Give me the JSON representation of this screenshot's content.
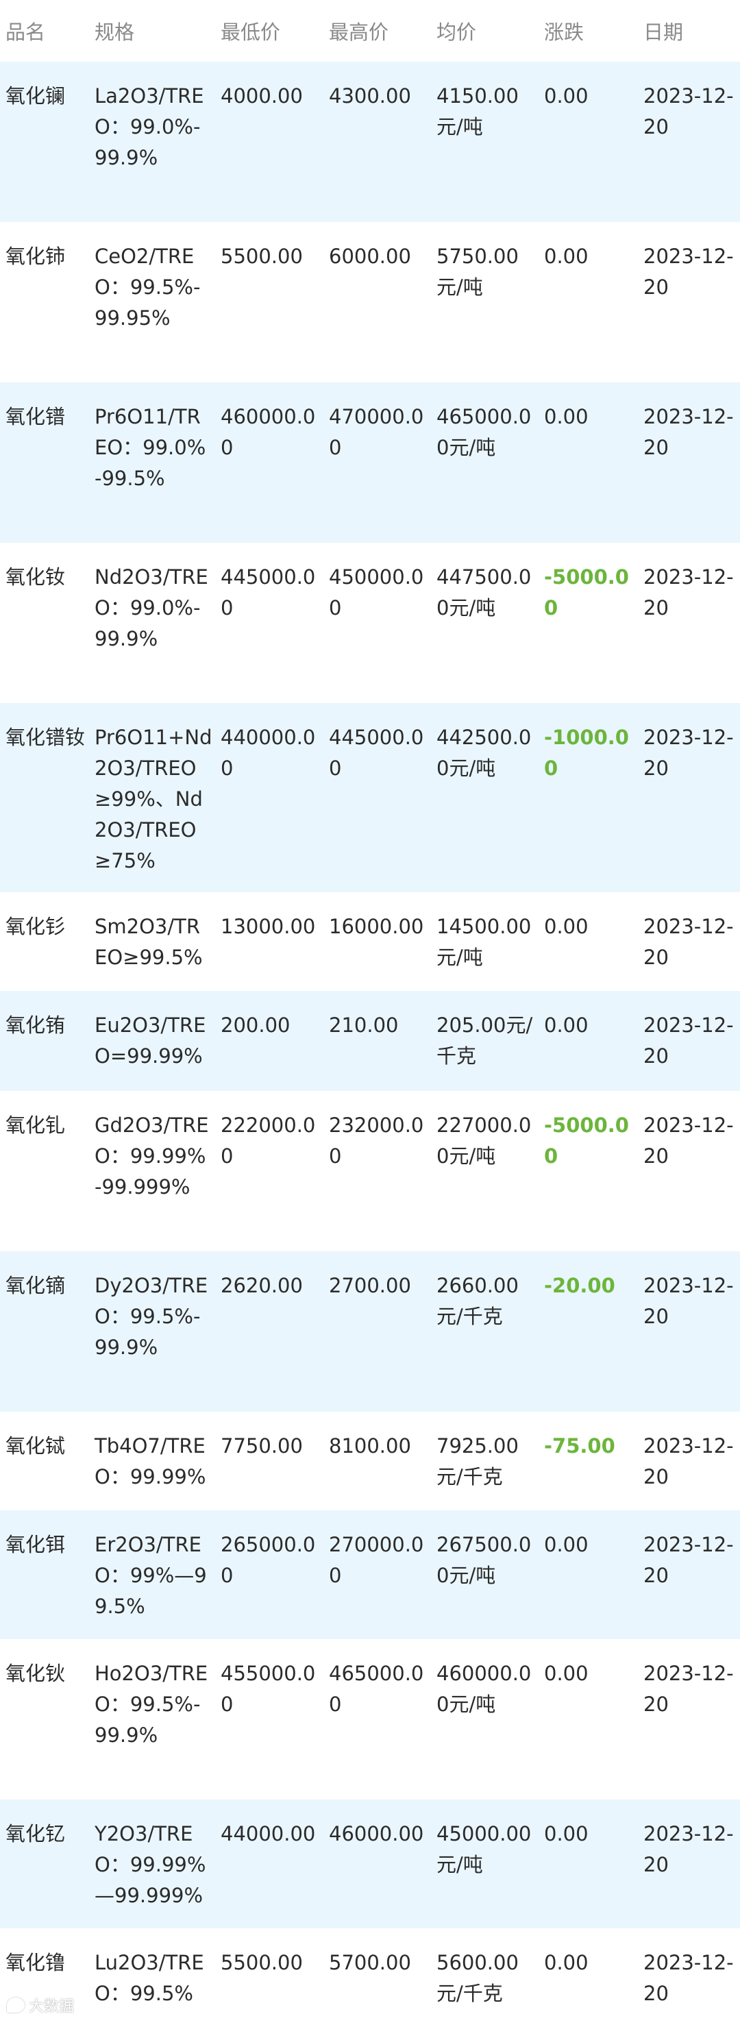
{
  "header": {
    "name": "品名",
    "spec": "规格",
    "low": "最低价",
    "high": "最高价",
    "avg": "均价",
    "change": "涨跌",
    "date": "日期"
  },
  "rows": [
    {
      "name": "氧化镧",
      "spec": "La2O3/TREO：99.0%-99.9%",
      "low": "4000.00",
      "high": "4300.00",
      "avg": "4150.00元/吨",
      "change": "0.00",
      "date": "2023-12-20"
    },
    {
      "name": "氧化铈",
      "spec": "CeO2/TREO：99.5%-99.95%",
      "low": "5500.00",
      "high": "6000.00",
      "avg": "5750.00元/吨",
      "change": "0.00",
      "date": "2023-12-20"
    },
    {
      "name": "氧化镨",
      "spec": "Pr6O11/TREO：99.0%-99.5%",
      "low": "460000.00",
      "high": "470000.00",
      "avg": "465000.00元/吨",
      "change": "0.00",
      "date": "2023-12-20"
    },
    {
      "name": "氧化钕",
      "spec": "Nd2O3/TREO：99.0%-99.9%",
      "low": "445000.00",
      "high": "450000.00",
      "avg": "447500.00元/吨",
      "change": "-5000.00",
      "date": "2023-12-20"
    },
    {
      "name": "氧化镨钕",
      "spec": "Pr6O11+Nd2O3/TREO≥99%、Nd2O3/TREO≥75%",
      "low": "440000.00",
      "high": "445000.00",
      "avg": "442500.00元/吨",
      "change": "-1000.00",
      "date": "2023-12-20"
    },
    {
      "name": "氧化钐",
      "spec": "Sm2O3/TREO≥99.5%",
      "low": "13000.00",
      "high": "16000.00",
      "avg": "14500.00元/吨",
      "change": "0.00",
      "date": "2023-12-20"
    },
    {
      "name": "氧化铕",
      "spec": "Eu2O3/TREO=99.99%",
      "low": "200.00",
      "high": "210.00",
      "avg": "205.00元/千克",
      "change": "0.00",
      "date": "2023-12-20"
    },
    {
      "name": "氧化钆",
      "spec": "Gd2O3/TREO：99.99%-99.999%",
      "low": "222000.00",
      "high": "232000.00",
      "avg": "227000.00元/吨",
      "change": "-5000.00",
      "date": "2023-12-20"
    },
    {
      "name": "氧化镝",
      "spec": "Dy2O3/TREO：99.5%-99.9%",
      "low": "2620.00",
      "high": "2700.00",
      "avg": "2660.00元/千克",
      "change": "-20.00",
      "date": "2023-12-20"
    },
    {
      "name": "氧化铽",
      "spec": "Tb4O7/TREO：99.99%",
      "low": "7750.00",
      "high": "8100.00",
      "avg": "7925.00元/千克",
      "change": "-75.00",
      "date": "2023-12-20"
    },
    {
      "name": "氧化铒",
      "spec": "Er2O3/TREO：99%—99.5%",
      "low": "265000.00",
      "high": "270000.00",
      "avg": "267500.00元/吨",
      "change": "0.00",
      "date": "2023-12-20"
    },
    {
      "name": "氧化钬",
      "spec": "Ho2O3/TREO：99.5%-99.9%",
      "low": "455000.00",
      "high": "465000.00",
      "avg": "460000.00元/吨",
      "change": "0.00",
      "date": "2023-12-20"
    },
    {
      "name": "氧化钇",
      "spec": "Y2O3/TREO：99.99%—99.999%",
      "low": "44000.00",
      "high": "46000.00",
      "avg": "45000.00元/吨",
      "change": "0.00",
      "date": "2023-12-20"
    },
    {
      "name": "氧化镥",
      "spec": "Lu2O3/TREO：99.5%",
      "low": "5500.00",
      "high": "5700.00",
      "avg": "5600.00元/千克",
      "change": "0.00",
      "date": "2023-12-20"
    }
  ],
  "watermark": {
    "text": "大数据"
  },
  "colors": {
    "row_alt": "#eaf6fd",
    "negative_change": "#6cb53c",
    "header_text": "#8a8a8a"
  }
}
